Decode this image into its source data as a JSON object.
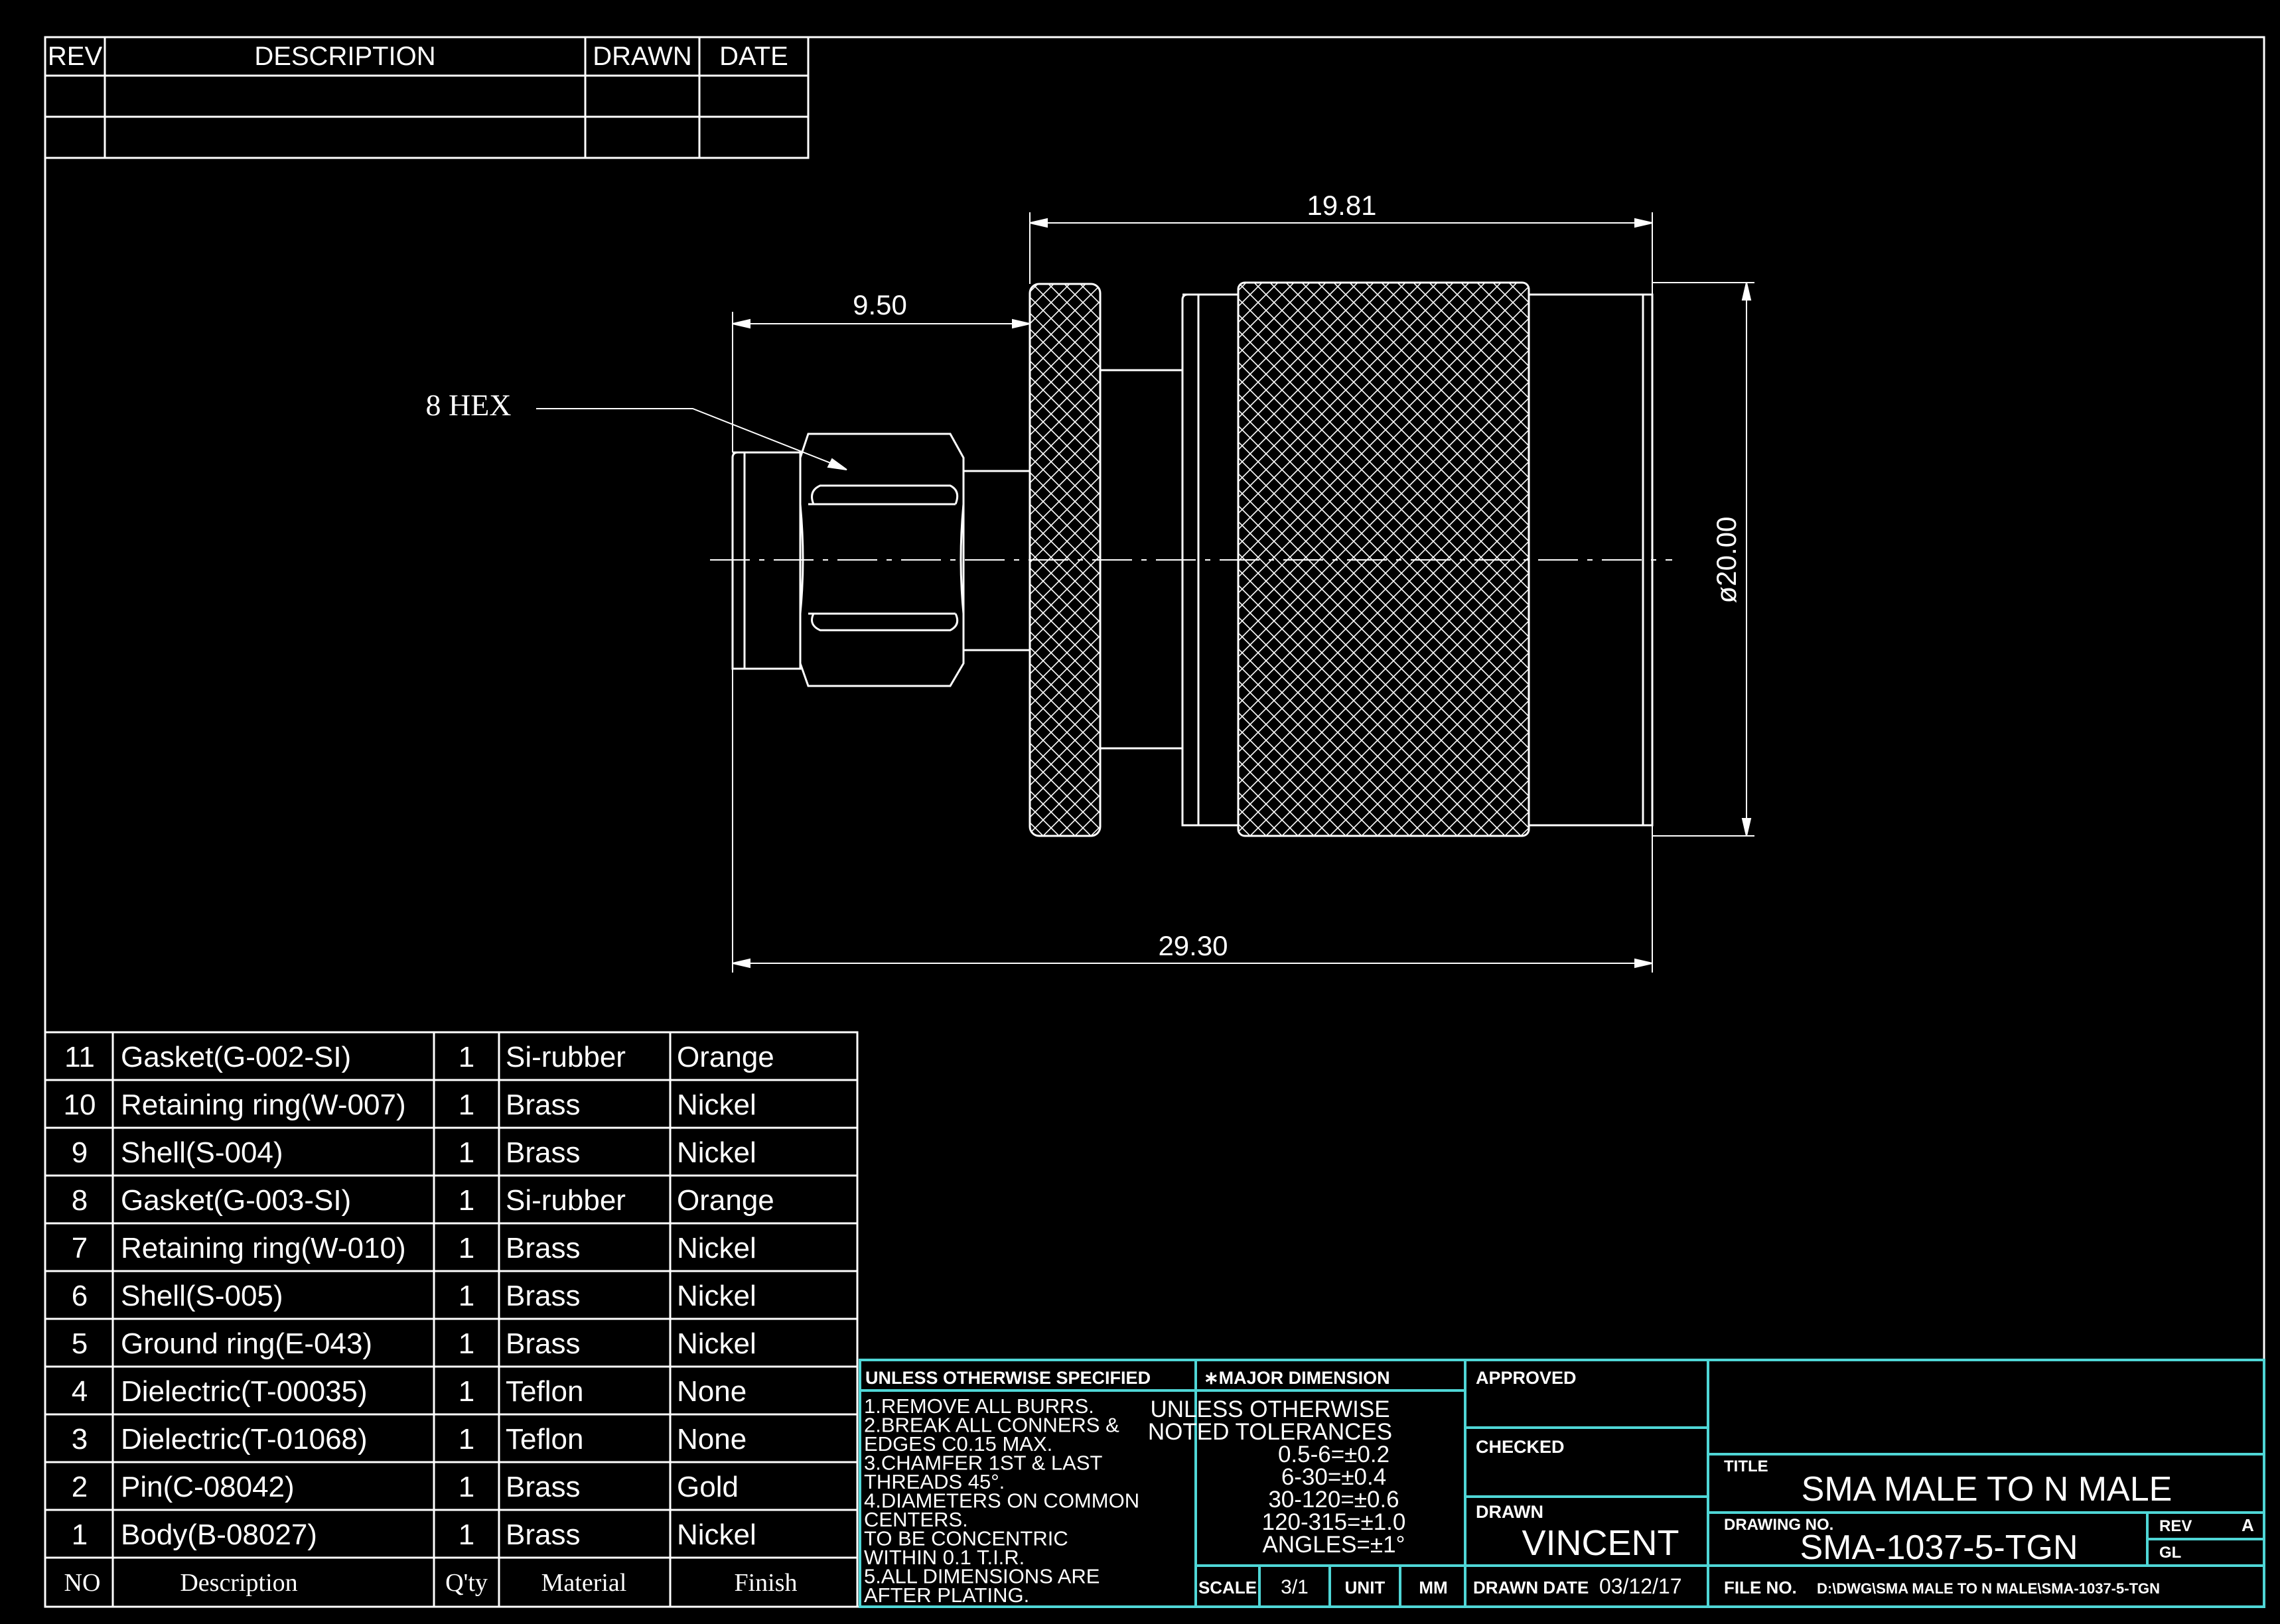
{
  "revision_table": {
    "headers": [
      "REV",
      "DESCRIPTION",
      "DRAWN",
      "DATE"
    ]
  },
  "dimensions": {
    "overall_length": "29.30",
    "body_length": "19.81",
    "hex_offset": "9.50",
    "diameter": "ø20.00",
    "hex_label": "8 HEX"
  },
  "bom": {
    "rows": [
      {
        "no": "11",
        "description": "Gasket(G-002-SI)",
        "qty": "1",
        "material": "Si-rubber",
        "finish": "Orange"
      },
      {
        "no": "10",
        "description": "Retaining ring(W-007)",
        "qty": "1",
        "material": "Brass",
        "finish": "Nickel"
      },
      {
        "no": "9",
        "description": "Shell(S-004)",
        "qty": "1",
        "material": "Brass",
        "finish": "Nickel"
      },
      {
        "no": "8",
        "description": "Gasket(G-003-SI)",
        "qty": "1",
        "material": "Si-rubber",
        "finish": "Orange"
      },
      {
        "no": "7",
        "description": "Retaining ring(W-010)",
        "qty": "1",
        "material": "Brass",
        "finish": "Nickel"
      },
      {
        "no": "6",
        "description": "Shell(S-005)",
        "qty": "1",
        "material": "Brass",
        "finish": "Nickel"
      },
      {
        "no": "5",
        "description": "Ground ring(E-043)",
        "qty": "1",
        "material": "Brass",
        "finish": "Nickel"
      },
      {
        "no": "4",
        "description": "Dielectric(T-00035)",
        "qty": "1",
        "material": "Teflon",
        "finish": "None"
      },
      {
        "no": "3",
        "description": "Dielectric(T-01068)",
        "qty": "1",
        "material": "Teflon",
        "finish": "None"
      },
      {
        "no": "2",
        "description": "Pin(C-08042)",
        "qty": "1",
        "material": "Brass",
        "finish": "Gold"
      },
      {
        "no": "1",
        "description": "Body(B-08027)",
        "qty": "1",
        "material": "Brass",
        "finish": "Nickel"
      }
    ],
    "footer": {
      "no": "NO",
      "description": "Description",
      "qty": "Q'ty",
      "material": "Material",
      "finish": "Finish"
    }
  },
  "title_block": {
    "unless_header": "UNLESS OTHERWISE SPECIFIED",
    "notes": [
      "1.REMOVE ALL BURRS.",
      "2.BREAK ALL CONNERS &",
      "  EDGES C0.15 MAX.",
      "3.CHAMFER 1ST & LAST",
      "  THREADS 45°.",
      "4.DIAMETERS ON COMMON",
      "  CENTERS.",
      "  TO BE CONCENTRIC",
      "  WITHIN 0.1 T.I.R.",
      "5.ALL DIMENSIONS ARE",
      "  AFTER PLATING."
    ],
    "major_dimension_header": "∗MAJOR DIMENSION",
    "tolerance_lines": [
      "UNLESS OTHERWISE",
      "NOTED TOLERANCES",
      "0.5-6=±0.2",
      "6-30=±0.4",
      "30-120=±0.6",
      "120-315=±1.0",
      "ANGLES=±1°"
    ],
    "scale_label": "SCALE",
    "scale_value": "3/1",
    "unit_label": "UNIT",
    "unit_value": "MM",
    "approved_label": "APPROVED",
    "checked_label": "CHECKED",
    "drawn_label": "DRAWN",
    "drawn_value": "VINCENT",
    "drawn_date_label": "DRAWN DATE",
    "drawn_date_value": "03/12/17",
    "title_label": "TITLE",
    "title_value": "SMA MALE TO N MALE",
    "drawing_no_label": "DRAWING NO.",
    "drawing_no_value": "SMA-1037-5-TGN",
    "rev_label": "REV",
    "rev_value": "A",
    "gl_label": "GL",
    "file_no_label": "FILE NO.",
    "file_no_value": "D:\\DWG\\SMA MALE TO N MALE\\SMA-1037-5-TGN"
  },
  "colors": {
    "background": "#000000",
    "line": "#ffffff",
    "title_block_border": "#4fd6d6"
  }
}
